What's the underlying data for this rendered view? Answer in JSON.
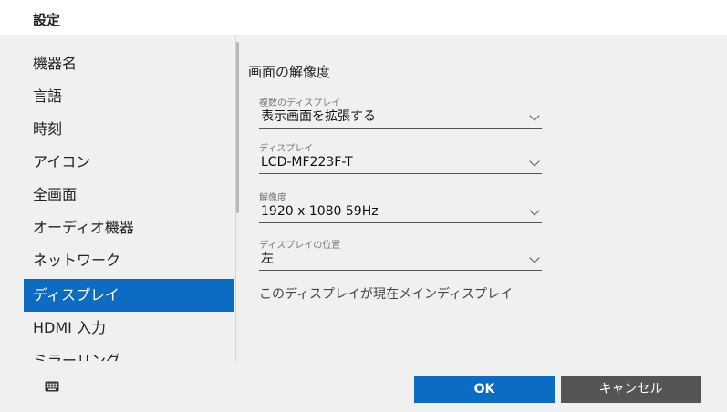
{
  "window": {
    "title": "設定"
  },
  "sidebar": {
    "items": [
      {
        "label": "機器名"
      },
      {
        "label": "言語"
      },
      {
        "label": "時刻"
      },
      {
        "label": "アイコン"
      },
      {
        "label": "全画面"
      },
      {
        "label": "オーディオ機器"
      },
      {
        "label": "ネットワーク"
      },
      {
        "label": "ディスプレイ",
        "selected": true
      },
      {
        "label": "HDMI 入力"
      },
      {
        "label": "ミラーリング"
      }
    ]
  },
  "main": {
    "title": "画面の解像度",
    "fields": [
      {
        "label": "複数のディスプレイ",
        "value": "表示画面を拡張する"
      },
      {
        "label": "ディスプレイ",
        "value": "LCD-MF223F-T"
      },
      {
        "label": "解像度",
        "value": "1920 x 1080 59Hz"
      },
      {
        "label": "ディスプレイの位置",
        "value": "左"
      }
    ],
    "info": "このディスプレイが現在メインディスプレイ"
  },
  "footer": {
    "keyboard_icon": "keyboard-icon",
    "ok_label": "OK",
    "cancel_label": "キャンセル"
  },
  "colors": {
    "accent": "#0b6cc2",
    "cancel_button": "#555555",
    "background": "#f0f0f0"
  }
}
